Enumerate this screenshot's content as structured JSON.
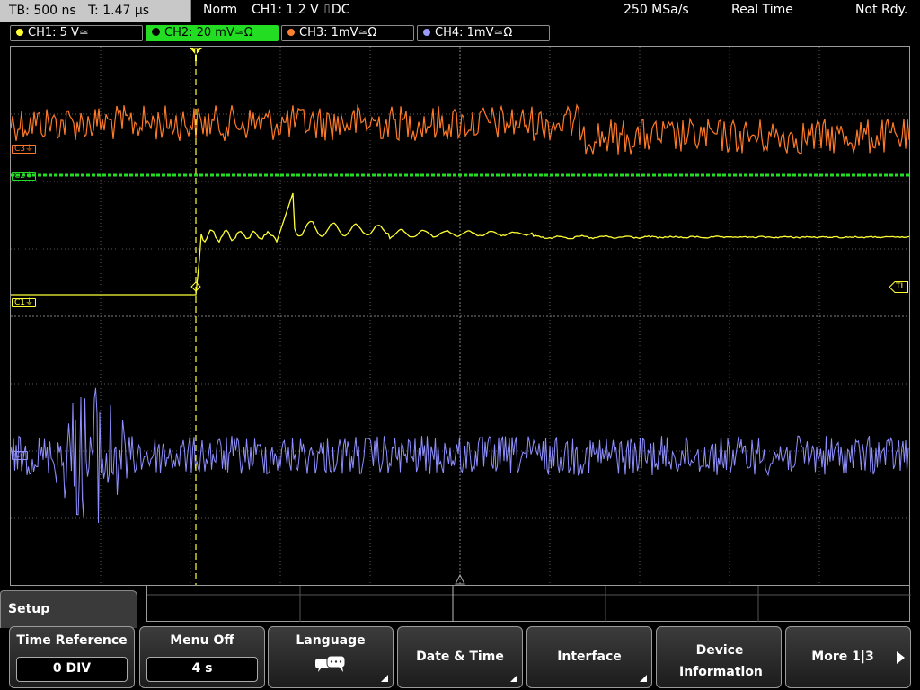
{
  "status": {
    "timebase": "TB: 500 ns",
    "trigger_time": "T: 1.47 µs",
    "trigger_mode": "Norm",
    "trigger_source": "CH1: 1.2 V ⎍DC",
    "sample_rate": "250 MSa/s",
    "acq_mode": "Real Time",
    "state": "Not Rdy."
  },
  "channels": [
    {
      "label": "CH1: 5 V≃",
      "color": "#ffff33",
      "active": false
    },
    {
      "label": "CH2: 20 mV≃Ω",
      "color": "#22dd22",
      "active": true
    },
    {
      "label": "CH3: 1mV≃Ω",
      "color": "#ff8030",
      "active": false
    },
    {
      "label": "CH4: 1mV≃Ω",
      "color": "#9a9aff",
      "active": false
    }
  ],
  "markers": {
    "c1": "C1⏚",
    "c2": "C2⏚",
    "c3": "C3⏚",
    "c4": "C4",
    "trigger_level": "TL",
    "trigger_pos": "T"
  },
  "colors": {
    "ch1": "#ffff33",
    "ch2": "#22dd22",
    "ch3": "#ff7a28",
    "ch4": "#8f8fff",
    "grid": "#5a5a5a",
    "trigger": "#ffff33"
  },
  "menu": {
    "title": "Setup",
    "softkeys": [
      {
        "label": "Time Reference",
        "value": "0 DIV"
      },
      {
        "label": "Menu Off",
        "value": "4 s"
      },
      {
        "label": "Language",
        "icon": "speech-bubble-icon"
      },
      {
        "label": "Date & Time"
      },
      {
        "label": "Interface"
      },
      {
        "label": "Device Information"
      },
      {
        "label": "More 1|3",
        "icon": "arrow-right-icon"
      }
    ]
  }
}
